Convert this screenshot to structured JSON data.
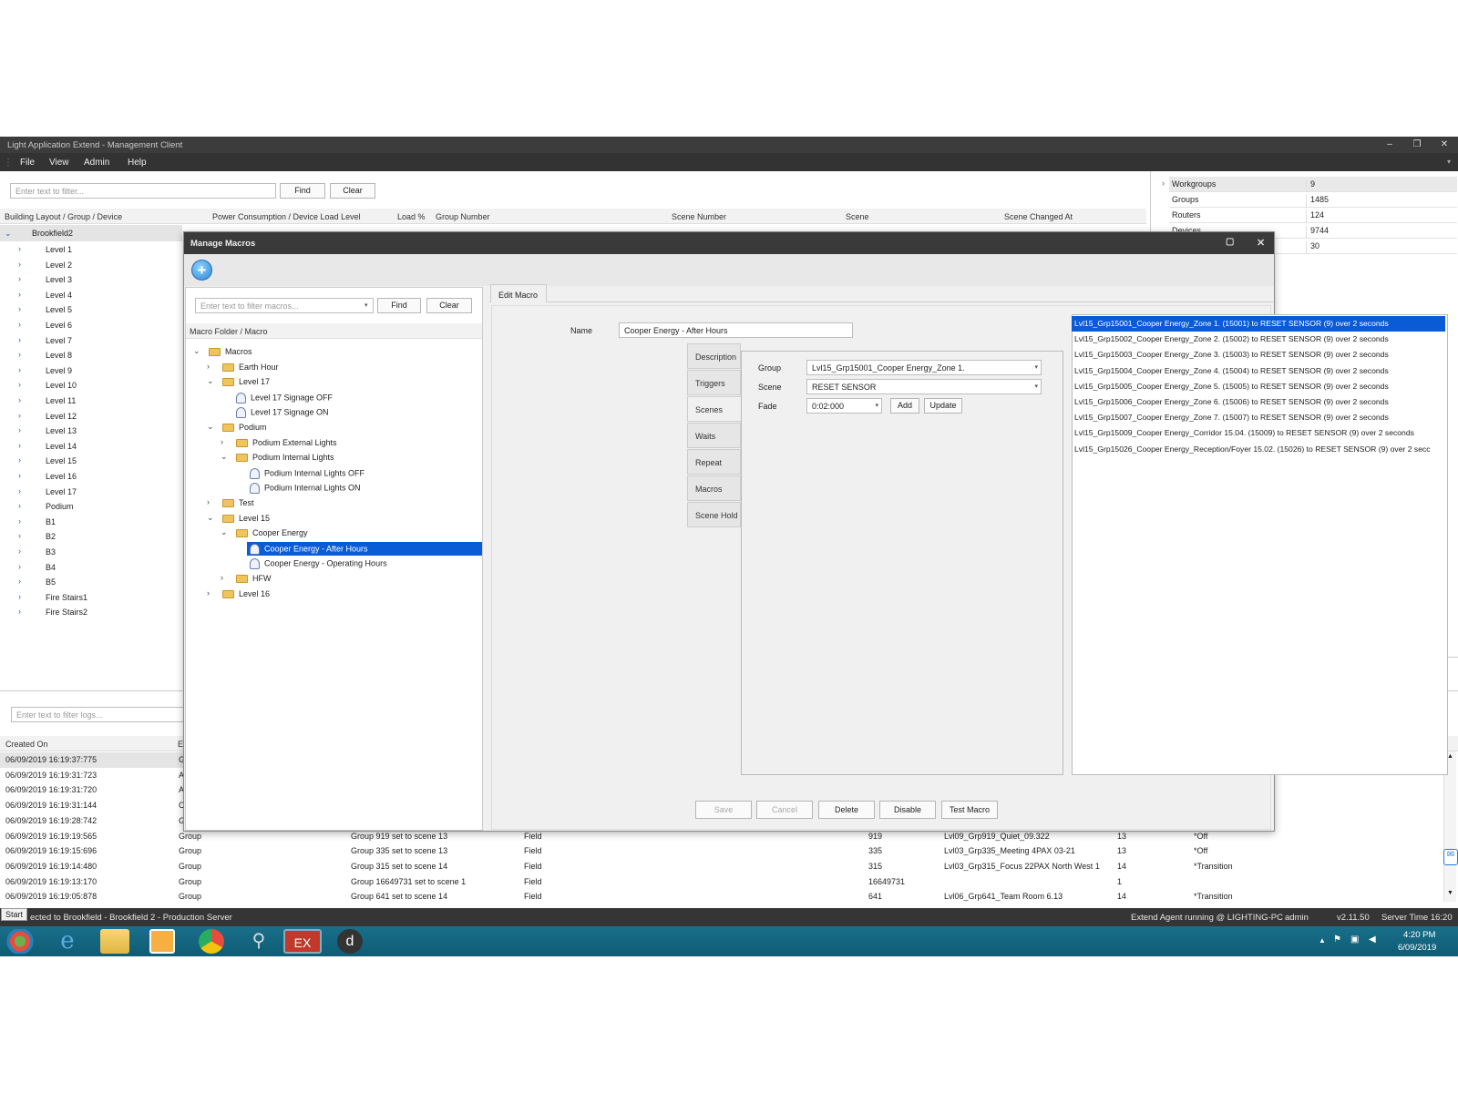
{
  "window": {
    "title": "Light Application Extend - Management Client"
  },
  "menu": [
    "File",
    "View",
    "Admin",
    "Help"
  ],
  "filter": {
    "placeholder": "Enter text to filter...",
    "find": "Find",
    "clear": "Clear"
  },
  "grid_headers": [
    "Building Layout / Group / Device",
    "Power Consumption / Device Load Level",
    "Load %",
    "Group Number",
    "Scene Number",
    "Scene",
    "Scene Changed At"
  ],
  "building_root": "Brookfield2",
  "building_items": [
    "Level 1",
    "Level 2",
    "Level 3",
    "Level 4",
    "Level 5",
    "Level 6",
    "Level 7",
    "Level 8",
    "Level 9",
    "Level 10",
    "Level 11",
    "Level 12",
    "Level 13",
    "Level 14",
    "Level 15",
    "Level 16",
    "Level 17",
    "Podium",
    "B1",
    "B2",
    "B3",
    "B4",
    "B5",
    "Fire Stairs1",
    "Fire Stairs2"
  ],
  "stats": [
    {
      "label": "Workgroups",
      "value": "9"
    },
    {
      "label": "Groups",
      "value": "1485"
    },
    {
      "label": "Routers",
      "value": "124"
    },
    {
      "label": "Devices",
      "value": "9744"
    },
    {
      "label": "",
      "value": "30"
    }
  ],
  "logs": {
    "placeholder": "Enter text to filter logs...",
    "header_created": "Created On",
    "header_e": "E",
    "rows": [
      {
        "created": "06/09/2019 16:19:37:775",
        "a": "G",
        "b": "",
        "c": "",
        "d": "",
        "e": "",
        "f": "",
        "g": ""
      },
      {
        "created": "06/09/2019 16:19:31:723",
        "a": "A",
        "b": "",
        "c": "",
        "d": "",
        "e": "",
        "f": "",
        "g": ""
      },
      {
        "created": "06/09/2019 16:19:31:720",
        "a": "A",
        "b": "",
        "c": "",
        "d": "",
        "e": "",
        "f": "",
        "g": ""
      },
      {
        "created": "06/09/2019 16:19:31:144",
        "a": "C",
        "b": "",
        "c": "",
        "d": "",
        "e": "",
        "f": "",
        "g": ""
      },
      {
        "created": "06/09/2019 16:19:28:742",
        "a": "G",
        "b": "",
        "c": "",
        "d": "",
        "e": "",
        "f": "",
        "g": ""
      },
      {
        "created": "06/09/2019 16:19:19:565",
        "a": "Group",
        "b": "Group 919 set to scene 13",
        "c": "Field",
        "d": "919",
        "e": "Lvl09_Grp919_Quiet_09.322",
        "f": "13",
        "g": "*Off"
      },
      {
        "created": "06/09/2019 16:19:15:696",
        "a": "Group",
        "b": "Group 335 set to scene 13",
        "c": "Field",
        "d": "335",
        "e": "Lvl03_Grp335_Meeting 4PAX 03-21",
        "f": "13",
        "g": "*Off"
      },
      {
        "created": "06/09/2019 16:19:14:480",
        "a": "Group",
        "b": "Group 315 set to scene 14",
        "c": "Field",
        "d": "315",
        "e": "Lvl03_Grp315_Focus 22PAX North West 1",
        "f": "14",
        "g": "*Transition"
      },
      {
        "created": "06/09/2019 16:19:13:170",
        "a": "Group",
        "b": "Group 16649731 set to scene 1",
        "c": "Field",
        "d": "16649731",
        "e": "",
        "f": "1",
        "g": ""
      },
      {
        "created": "06/09/2019 16:19:05:878",
        "a": "Group",
        "b": "Group 641 set to scene 14",
        "c": "Field",
        "d": "641",
        "e": "Lvl06_Grp641_Team Room 6.13",
        "f": "14",
        "g": "*Transition"
      }
    ]
  },
  "status": {
    "start": "Start",
    "connected": "ected to Brookfield - Brookfield 2 - Production Server",
    "agent": "Extend Agent running @ LIGHTING-PC",
    "user": "admin",
    "version": "v2.11.50",
    "server_time": "Server Time 16:20"
  },
  "clock": {
    "time": "4:20 PM",
    "date": "6/09/2019"
  },
  "modal": {
    "title": "Manage Macros",
    "filter_placeholder": "Enter text to filter macros...",
    "find": "Find",
    "clear": "Clear",
    "tree_header": "Macro Folder / Macro",
    "tree": [
      {
        "label": "Macros",
        "type": "folder",
        "depth": 0,
        "exp": "down"
      },
      {
        "label": "Earth Hour",
        "type": "folder",
        "depth": 1,
        "exp": "right"
      },
      {
        "label": "Level 17",
        "type": "folder",
        "depth": 1,
        "exp": "down"
      },
      {
        "label": "Level 17 Signage OFF",
        "type": "macro",
        "depth": 2,
        "exp": ""
      },
      {
        "label": "Level 17 Signage ON",
        "type": "macro",
        "depth": 2,
        "exp": ""
      },
      {
        "label": "Podium",
        "type": "folder",
        "depth": 1,
        "exp": "down"
      },
      {
        "label": "Podium External Lights",
        "type": "folder",
        "depth": 2,
        "exp": "right"
      },
      {
        "label": "Podium Internal Lights",
        "type": "folder",
        "depth": 2,
        "exp": "down"
      },
      {
        "label": "Podium Internal Lights OFF",
        "type": "macro",
        "depth": 3,
        "exp": ""
      },
      {
        "label": "Podium Internal Lights ON",
        "type": "macro",
        "depth": 3,
        "exp": ""
      },
      {
        "label": "Test",
        "type": "folder",
        "depth": 1,
        "exp": "right"
      },
      {
        "label": "Level 15",
        "type": "folder",
        "depth": 1,
        "exp": "down"
      },
      {
        "label": "Cooper Energy",
        "type": "folder",
        "depth": 2,
        "exp": "down"
      },
      {
        "label": "Cooper Energy - After Hours",
        "type": "macro",
        "depth": 3,
        "exp": "",
        "selected": true
      },
      {
        "label": "Cooper Energy - Operating Hours",
        "type": "macro",
        "depth": 3,
        "exp": ""
      },
      {
        "label": "HFW",
        "type": "folder",
        "depth": 2,
        "exp": "right"
      },
      {
        "label": "Level 16",
        "type": "folder",
        "depth": 1,
        "exp": "right"
      }
    ],
    "edit_tab": "Edit Macro",
    "name_label": "Name",
    "name_value": "Cooper Energy - After Hours",
    "side_tabs": [
      "Description",
      "Triggers",
      "Scenes",
      "Waits",
      "Repeat",
      "Macros",
      "Scene Hold"
    ],
    "active_side_tab": "Scenes",
    "group_label": "Group",
    "group_value": "Lvl15_Grp15001_Cooper Energy_Zone 1.",
    "scene_label": "Scene",
    "scene_value": "RESET SENSOR",
    "fade_label": "Fade",
    "fade_value": "0:02:000",
    "add": "Add",
    "update": "Update",
    "scene_list": [
      "Lvl15_Grp15001_Cooper Energy_Zone 1. (15001) to RESET SENSOR (9) over 2 seconds",
      "Lvl15_Grp15002_Cooper Energy_Zone 2. (15002) to RESET SENSOR (9) over 2 seconds",
      "Lvl15_Grp15003_Cooper Energy_Zone 3. (15003) to RESET SENSOR (9) over 2 seconds",
      "Lvl15_Grp15004_Cooper Energy_Zone 4. (15004) to RESET SENSOR (9) over 2 seconds",
      "Lvl15_Grp15005_Cooper Energy_Zone 5. (15005) to RESET SENSOR (9) over 2 seconds",
      "Lvl15_Grp15006_Cooper Energy_Zone 6. (15006) to RESET SENSOR (9) over 2 seconds",
      "Lvl15_Grp15007_Cooper Energy_Zone 7. (15007) to RESET SENSOR (9) over 2 seconds",
      "Lvl15_Grp15009_Cooper Energy_Corridor 15.04. (15009) to RESET SENSOR (9) over 2 seconds",
      "Lvl15_Grp15026_Cooper Energy_Reception/Foyer 15.02. (15026) to RESET SENSOR (9) over 2 secc"
    ],
    "buttons": {
      "save": "Save",
      "cancel": "Cancel",
      "delete": "Delete",
      "disable": "Disable",
      "test": "Test Macro"
    }
  },
  "colors": {
    "accent": "#0a5bd6",
    "titlebar": "#3c3c3c",
    "taskbar": "#136680"
  }
}
